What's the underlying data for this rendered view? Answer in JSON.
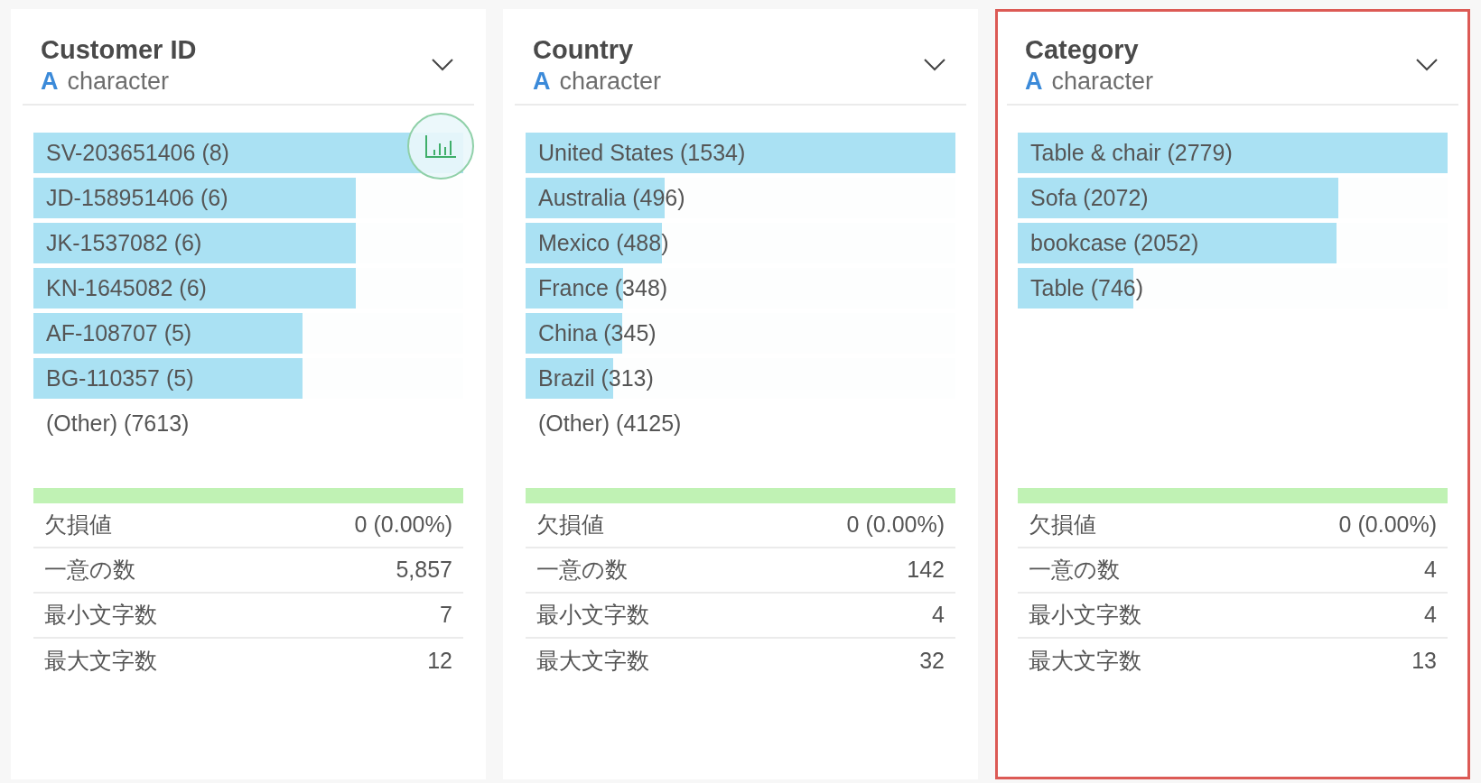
{
  "cards": [
    {
      "title": "Customer ID",
      "type_icon": "A",
      "type": "character",
      "selected": false,
      "chart_button": true,
      "bars": [
        {
          "label": "SV-203651406 (8)",
          "level": 1
        },
        {
          "label": "JD-158951406 (6)",
          "level": 0.75
        },
        {
          "label": "JK-1537082 (6)",
          "level": 0.75
        },
        {
          "label": "KN-1645082 (6)",
          "level": 0.75
        },
        {
          "label": "AF-108707 (5)",
          "level": 0.625
        },
        {
          "label": "BG-110357 (5)",
          "level": 0.625
        }
      ],
      "other": "(Other) (7613)",
      "completeness": {
        "level": 1
      },
      "stats": [
        {
          "label": "欠損値",
          "value": "0 (0.00%)"
        },
        {
          "label": "一意の数",
          "value": "5,857"
        },
        {
          "label": "最小文字数",
          "value": "7"
        },
        {
          "label": "最大文字数",
          "value": "12"
        }
      ]
    },
    {
      "title": "Country",
      "type_icon": "A",
      "type": "character",
      "selected": false,
      "chart_button": false,
      "bars": [
        {
          "label": "United States (1534)",
          "level": 1
        },
        {
          "label": "Australia (496)",
          "level": 0.323
        },
        {
          "label": "Mexico (488)",
          "level": 0.318
        },
        {
          "label": "France (348)",
          "level": 0.227
        },
        {
          "label": "China (345)",
          "level": 0.225
        },
        {
          "label": "Brazil (313)",
          "level": 0.204
        }
      ],
      "other": "(Other) (4125)",
      "completeness": {
        "level": 1
      },
      "stats": [
        {
          "label": "欠損値",
          "value": "0 (0.00%)"
        },
        {
          "label": "一意の数",
          "value": "142"
        },
        {
          "label": "最小文字数",
          "value": "4"
        },
        {
          "label": "最大文字数",
          "value": "32"
        }
      ]
    },
    {
      "title": "Category",
      "type_icon": "A",
      "type": "character",
      "selected": true,
      "chart_button": false,
      "bars": [
        {
          "label": "Table & chair (2779)",
          "level": 1
        },
        {
          "label": "Sofa (2072)",
          "level": 0.746
        },
        {
          "label": "bookcase (2052)",
          "level": 0.741
        },
        {
          "label": "Table (746)",
          "level": 0.268
        }
      ],
      "completeness": {
        "level": 1
      },
      "stats": [
        {
          "label": "欠損値",
          "value": "0 (0.00%)"
        },
        {
          "label": "一意の数",
          "value": "4"
        },
        {
          "label": "最小文字数",
          "value": "4"
        },
        {
          "label": "最大文字数",
          "value": "13"
        }
      ]
    }
  ]
}
